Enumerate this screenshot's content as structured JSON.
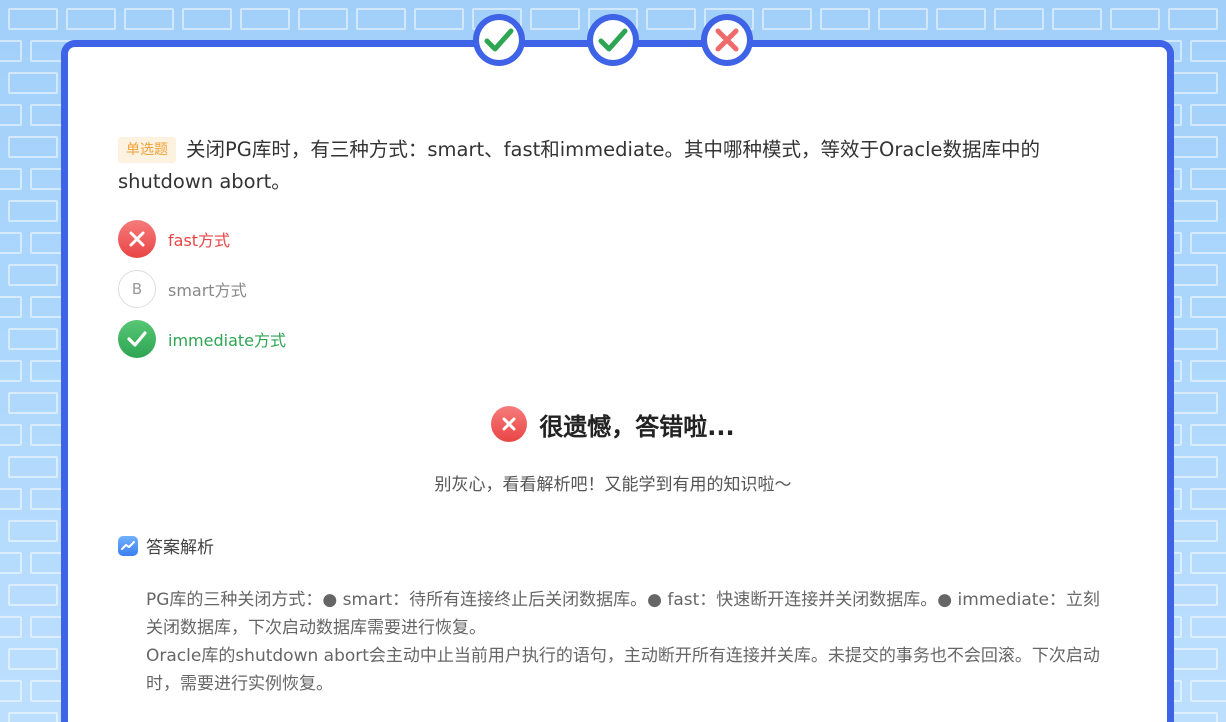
{
  "progress": [
    {
      "status": "correct",
      "icon": "check-icon"
    },
    {
      "status": "correct",
      "icon": "check-icon"
    },
    {
      "status": "wrong",
      "icon": "cross-icon"
    }
  ],
  "question": {
    "type_tag": "单选题",
    "text": "关闭PG库时，有三种方式：smart、fast和immediate。其中哪种模式，等效于Oracle数据库中的shutdown abort。"
  },
  "options": [
    {
      "label": "fast方式",
      "state": "wrong",
      "icon": "cross-icon"
    },
    {
      "letter": "B",
      "label": "smart方式",
      "state": "neutral"
    },
    {
      "label": "immediate方式",
      "state": "right",
      "icon": "check-icon"
    }
  ],
  "result": {
    "title": "很遗憾，答错啦...",
    "subtitle": "别灰心，看看解析吧！又能学到有用的知识啦～"
  },
  "analysis": {
    "heading": "答案解析",
    "line1": "PG库的三种关闭方式：● smart：待所有连接终止后关闭数据库。● fast：快速断开连接并关闭数据库。● immediate：立刻关闭数据库，下次启动数据库需要进行恢复。",
    "line2": "Oracle库的shutdown abort会主动中止当前用户执行的语句，主动断开所有连接并关库。未提交的事务也不会回滚。下次启动时，需要进行实例恢复。"
  },
  "colors": {
    "accent": "#3e63e6",
    "correct": "#2ea553",
    "wrong": "#e94545",
    "tag_bg": "#fdf1df",
    "tag_text": "#f0a23b"
  }
}
